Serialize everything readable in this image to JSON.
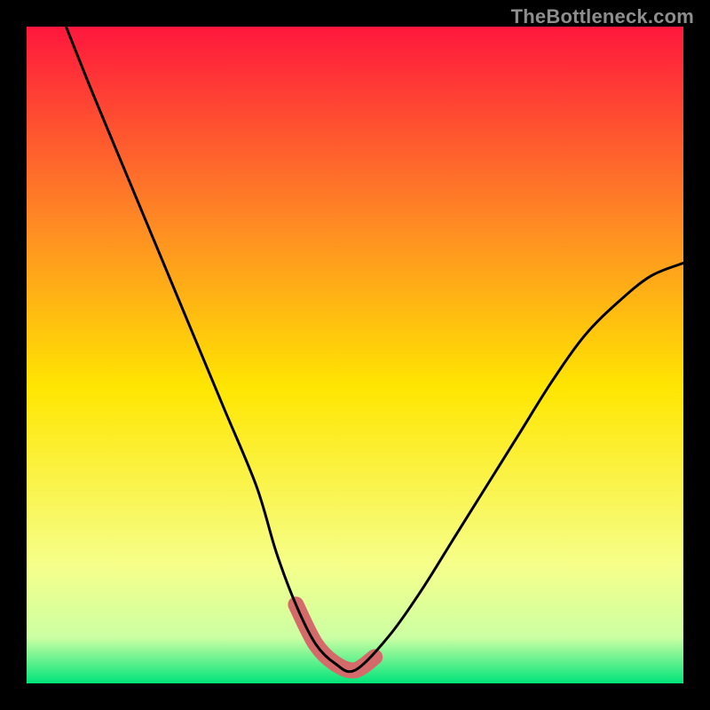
{
  "watermark": "TheBottleneck.com",
  "colors": {
    "frame": "#000000",
    "grad_top": "#ff173d",
    "grad_q1": "#ff8a24",
    "grad_mid": "#ffe601",
    "grad_q3": "#f6ff8a",
    "grad_low": "#ccffa3",
    "grad_bottom": "#00e47a",
    "curve": "#000000",
    "highlight": "#d46a6a"
  },
  "chart_data": {
    "type": "line",
    "title": "",
    "xlabel": "",
    "ylabel": "",
    "xlim": [
      0,
      100
    ],
    "ylim": [
      0,
      100
    ],
    "series": [
      {
        "name": "bottleneck-curve",
        "x": [
          6,
          10,
          15,
          20,
          25,
          30,
          35,
          38,
          41,
          44,
          47,
          50,
          55,
          60,
          65,
          70,
          75,
          80,
          85,
          90,
          95,
          100
        ],
        "values": [
          100,
          90,
          78,
          66,
          54,
          42,
          30,
          20,
          12,
          6,
          3,
          2,
          7,
          14,
          22,
          30,
          38,
          46,
          53,
          58,
          62,
          64
        ]
      }
    ],
    "highlight_region": {
      "name": "minimum-band",
      "x": [
        41,
        44,
        47,
        50,
        53
      ],
      "values": [
        12,
        6,
        3,
        2,
        4
      ]
    }
  }
}
